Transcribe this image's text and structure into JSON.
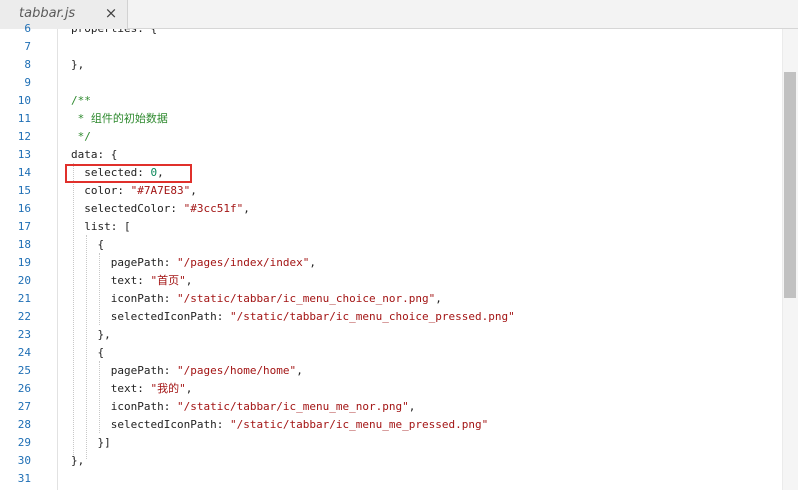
{
  "tab": {
    "title": "tabbar.js",
    "close_icon": "×"
  },
  "code": [
    {
      "n": "6",
      "segs": [
        {
          "c": "plain",
          "t": "properties: {"
        }
      ]
    },
    {
      "n": "7",
      "segs": []
    },
    {
      "n": "8",
      "segs": [
        {
          "c": "plain",
          "t": "},"
        }
      ]
    },
    {
      "n": "9",
      "segs": []
    },
    {
      "n": "10",
      "segs": [
        {
          "c": "comment",
          "t": "/**"
        }
      ]
    },
    {
      "n": "11",
      "segs": [
        {
          "c": "comment",
          "t": " * 组件的初始数据"
        }
      ]
    },
    {
      "n": "12",
      "segs": [
        {
          "c": "comment",
          "t": " */"
        }
      ]
    },
    {
      "n": "13",
      "segs": [
        {
          "c": "plain",
          "t": "data: {"
        }
      ]
    },
    {
      "n": "14",
      "segs": [
        {
          "c": "plain",
          "t": "  selected: "
        },
        {
          "c": "number",
          "t": "0"
        },
        {
          "c": "plain",
          "t": ","
        }
      ]
    },
    {
      "n": "15",
      "segs": [
        {
          "c": "plain",
          "t": "  color: "
        },
        {
          "c": "string",
          "t": "\"#7A7E83\""
        },
        {
          "c": "plain",
          "t": ","
        }
      ]
    },
    {
      "n": "16",
      "segs": [
        {
          "c": "plain",
          "t": "  selectedColor: "
        },
        {
          "c": "string",
          "t": "\"#3cc51f\""
        },
        {
          "c": "plain",
          "t": ","
        }
      ]
    },
    {
      "n": "17",
      "segs": [
        {
          "c": "plain",
          "t": "  list: ["
        }
      ]
    },
    {
      "n": "18",
      "segs": [
        {
          "c": "plain",
          "t": "    {"
        }
      ]
    },
    {
      "n": "19",
      "segs": [
        {
          "c": "plain",
          "t": "      pagePath: "
        },
        {
          "c": "string",
          "t": "\"/pages/index/index\""
        },
        {
          "c": "plain",
          "t": ","
        }
      ]
    },
    {
      "n": "20",
      "segs": [
        {
          "c": "plain",
          "t": "      text: "
        },
        {
          "c": "string",
          "t": "\"首页\""
        },
        {
          "c": "plain",
          "t": ","
        }
      ]
    },
    {
      "n": "21",
      "segs": [
        {
          "c": "plain",
          "t": "      iconPath: "
        },
        {
          "c": "string",
          "t": "\"/static/tabbar/ic_menu_choice_nor.png\""
        },
        {
          "c": "plain",
          "t": ","
        }
      ]
    },
    {
      "n": "22",
      "segs": [
        {
          "c": "plain",
          "t": "      selectedIconPath: "
        },
        {
          "c": "string",
          "t": "\"/static/tabbar/ic_menu_choice_pressed.png\""
        }
      ]
    },
    {
      "n": "23",
      "segs": [
        {
          "c": "plain",
          "t": "    },"
        }
      ]
    },
    {
      "n": "24",
      "segs": [
        {
          "c": "plain",
          "t": "    {"
        }
      ]
    },
    {
      "n": "25",
      "segs": [
        {
          "c": "plain",
          "t": "      pagePath: "
        },
        {
          "c": "string",
          "t": "\"/pages/home/home\""
        },
        {
          "c": "plain",
          "t": ","
        }
      ]
    },
    {
      "n": "26",
      "segs": [
        {
          "c": "plain",
          "t": "      text: "
        },
        {
          "c": "string",
          "t": "\"我的\""
        },
        {
          "c": "plain",
          "t": ","
        }
      ]
    },
    {
      "n": "27",
      "segs": [
        {
          "c": "plain",
          "t": "      iconPath: "
        },
        {
          "c": "string",
          "t": "\"/static/tabbar/ic_menu_me_nor.png\""
        },
        {
          "c": "plain",
          "t": ","
        }
      ]
    },
    {
      "n": "28",
      "segs": [
        {
          "c": "plain",
          "t": "      selectedIconPath: "
        },
        {
          "c": "string",
          "t": "\"/static/tabbar/ic_menu_me_pressed.png\""
        }
      ]
    },
    {
      "n": "29",
      "segs": [
        {
          "c": "plain",
          "t": "    }]"
        }
      ]
    },
    {
      "n": "30",
      "segs": [
        {
          "c": "plain",
          "t": "},"
        }
      ]
    },
    {
      "n": "31",
      "segs": []
    }
  ],
  "colors": {
    "comment": "#2f8a2f",
    "string": "#a31515",
    "number": "#098658",
    "line_number": "#1f6fb5",
    "highlight_box": "#e0302b"
  }
}
